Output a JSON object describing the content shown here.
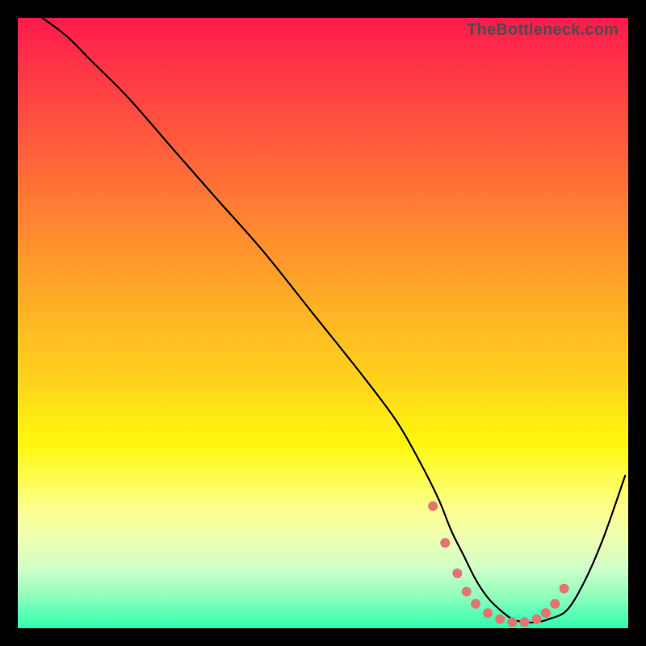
{
  "watermark": "TheBottleneck.com",
  "colors": {
    "frame_bg_top": "#ff1a4d",
    "frame_bg_bottom": "#2cffb0",
    "curve": "#000000",
    "dots": "#e27570",
    "page_bg": "#000000",
    "watermark": "#4c4c4c"
  },
  "chart_data": {
    "type": "line",
    "title": "",
    "xlabel": "",
    "ylabel": "",
    "xlim": [
      0,
      100
    ],
    "ylim": [
      0,
      100
    ],
    "grid": false,
    "legend": false,
    "series": [
      {
        "name": "bottleneck-curve",
        "x": [
          4,
          8,
          12,
          18,
          25,
          32,
          40,
          48,
          56,
          62,
          66,
          69,
          71,
          73,
          75,
          77,
          79,
          81,
          83,
          85,
          87,
          90,
          93,
          96,
          99.5
        ],
        "y": [
          100,
          97,
          93,
          87,
          79,
          71,
          62,
          52,
          42,
          34,
          27,
          21,
          16,
          12,
          8,
          5,
          3,
          1.5,
          1,
          1,
          1.5,
          3,
          8,
          15,
          25
        ]
      }
    ],
    "highlight_points": {
      "name": "optimal-range",
      "x": [
        68,
        70,
        72,
        73.5,
        75,
        77,
        79,
        81,
        83,
        85,
        86.5,
        88,
        89.5
      ],
      "y": [
        20,
        14,
        9,
        6,
        4,
        2.5,
        1.5,
        1,
        1,
        1.5,
        2.5,
        4,
        6.5
      ]
    }
  }
}
